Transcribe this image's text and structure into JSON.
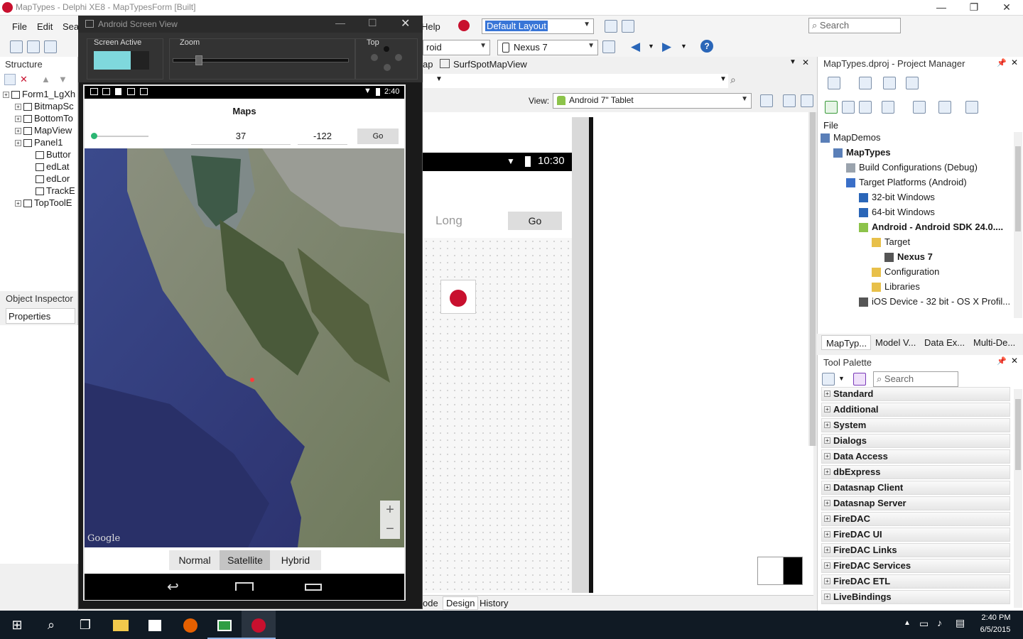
{
  "window": {
    "title": "MapTypes - Delphi XE8 - MapTypesForm [Built]"
  },
  "menubar": {
    "items": [
      "File",
      "Edit",
      "Sea"
    ],
    "help": "Help",
    "layout_combo": "Default Layout",
    "search_placeholder": "Search"
  },
  "toolbar2": {
    "platform_combo": "roid",
    "device_combo": "Nexus 7"
  },
  "tabs": {
    "designer_tab1": "ap",
    "designer_tab2": "SurfSpotMapView"
  },
  "view_bar": {
    "label": "View:",
    "value": "Android 7\" Tablet"
  },
  "structure": {
    "title": "Structure",
    "items": [
      {
        "label": "Form1_LgXh",
        "level": 0
      },
      {
        "label": "BitmapSc",
        "level": 1
      },
      {
        "label": "BottomTo",
        "level": 1
      },
      {
        "label": "MapView",
        "level": 1
      },
      {
        "label": "Panel1",
        "level": 1
      },
      {
        "label": "Buttor",
        "level": 2
      },
      {
        "label": "edLat",
        "level": 2
      },
      {
        "label": "edLor",
        "level": 2
      },
      {
        "label": "TrackE",
        "level": 2
      },
      {
        "label": "TopToolE",
        "level": 1
      }
    ]
  },
  "object_inspector": {
    "title": "Object Inspector",
    "tab": "Properties"
  },
  "asv": {
    "title": "Android Screen View",
    "screen_active_label": "Screen Active",
    "zoom_label": "Zoom",
    "top_label": "Top"
  },
  "phone": {
    "time": "2:40",
    "app_title": "Maps",
    "lat": "37",
    "long": "-122",
    "go": "Go",
    "map_tabs": [
      "Normal",
      "Satellite",
      "Hybrid"
    ],
    "selected_tab": "Satellite",
    "watermark": "Google",
    "zoom_plus": "+",
    "zoom_minus": "−"
  },
  "tablet": {
    "time": "10:30",
    "long_placeholder": "Long",
    "go": "Go"
  },
  "designer_bottom_tabs": [
    "ode",
    "Design",
    "History"
  ],
  "project_manager": {
    "title": "MapTypes.dproj - Project Manager",
    "file_label": "File",
    "items": [
      {
        "label": "MapDemos",
        "level": 0,
        "bold": false
      },
      {
        "label": "MapTypes",
        "level": 1,
        "bold": true
      },
      {
        "label": "Build Configurations (Debug)",
        "level": 2,
        "bold": false
      },
      {
        "label": "Target Platforms (Android)",
        "level": 2,
        "bold": false
      },
      {
        "label": "32-bit Windows",
        "level": 3,
        "bold": false
      },
      {
        "label": "64-bit Windows",
        "level": 3,
        "bold": false
      },
      {
        "label": "Android - Android SDK 24.0....",
        "level": 3,
        "bold": true
      },
      {
        "label": "Target",
        "level": 4,
        "bold": false
      },
      {
        "label": "Nexus 7",
        "level": 5,
        "bold": true
      },
      {
        "label": "Configuration",
        "level": 4,
        "bold": false
      },
      {
        "label": "Libraries",
        "level": 4,
        "bold": false
      },
      {
        "label": "iOS Device - 32 bit - OS X Profil...",
        "level": 3,
        "bold": false
      }
    ],
    "bottom_tabs": [
      "MapTyp...",
      "Model V...",
      "Data Ex...",
      "Multi-De..."
    ]
  },
  "tool_palette": {
    "title": "Tool Palette",
    "search_placeholder": "Search",
    "categories": [
      "Standard",
      "Additional",
      "System",
      "Dialogs",
      "Data Access",
      "dbExpress",
      "Datasnap Client",
      "Datasnap Server",
      "FireDAC",
      "FireDAC UI",
      "FireDAC Links",
      "FireDAC Services",
      "FireDAC ETL",
      "LiveBindings"
    ]
  },
  "taskbar": {
    "time": "2:40 PM",
    "date": "6/5/2015"
  }
}
